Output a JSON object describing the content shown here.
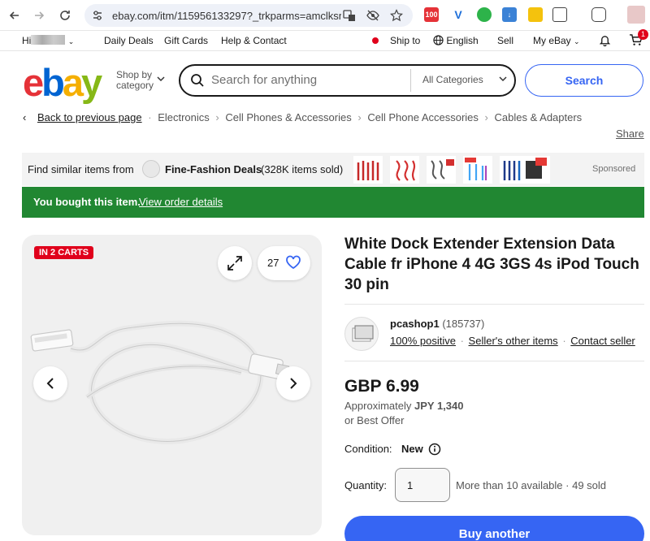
{
  "browser": {
    "url": "ebay.com/itm/115956133297?_trkparms=amclksr...",
    "ext_badge": "100"
  },
  "topbar": {
    "greeting": "Hi",
    "daily_deals": "Daily Deals",
    "gift_cards": "Gift Cards",
    "help": "Help & Contact",
    "ship_to": "Ship to",
    "language": "English",
    "sell": "Sell",
    "my_ebay": "My eBay",
    "cart_count": "1"
  },
  "header": {
    "logo": {
      "e": "e",
      "b": "b",
      "a": "a",
      "y": "y"
    },
    "shop_by_line1": "Shop by",
    "shop_by_line2": "category",
    "search_placeholder": "Search for anything",
    "category": "All Categories",
    "search_button": "Search"
  },
  "breadcrumb": {
    "back": "Back to previous page",
    "items": [
      "Electronics",
      "Cell Phones & Accessories",
      "Cell Phone Accessories",
      "Cables & Adapters"
    ],
    "share": "Share"
  },
  "similar": {
    "prefix": "Find similar items from",
    "store": "Fine-Fashion Deals",
    "sold": "(328K items sold)",
    "sponsored": "Sponsored"
  },
  "bought": {
    "message": "You bought this item.",
    "link": "View order details"
  },
  "gallery": {
    "badge": "IN 2 CARTS",
    "watch_count": "27"
  },
  "item": {
    "title": "White Dock Extender Extension Data Cable fr iPhone 4 4G 3GS 4s iPod Touch 30 pin",
    "seller": "pcashop1",
    "feedback": "(185737)",
    "positive": "100% positive",
    "other_items": "Seller's other items",
    "contact": "Contact seller",
    "price": "GBP 6.99",
    "approx_prefix": "Approximately",
    "approx_value": "JPY 1,340",
    "best_offer": "or Best Offer",
    "condition_label": "Condition:",
    "condition_value": "New",
    "quantity_label": "Quantity:",
    "quantity_value": "1",
    "availability": "More than 10 available · 49 sold",
    "buy_button": "Buy another"
  },
  "colors": {
    "accent": "#3665f3",
    "green_banner": "#218732",
    "badge_red": "#e0001b"
  }
}
